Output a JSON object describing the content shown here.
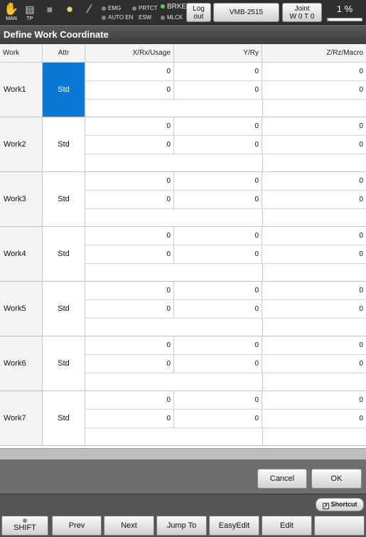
{
  "statusbar": {
    "mode_icon": "hand-icon",
    "mode_label": "MAN",
    "tp_icon": "teach-pendant-icon",
    "tp_label": "TP",
    "indicators": {
      "emg": "EMG",
      "autoen": "AUTO EN",
      "prtct": "PRTCT",
      "esw": "ESW",
      "brke": "BRKE",
      "mlck": "MLCK"
    },
    "logout_line1": "Log",
    "logout_line2": "out",
    "robot_name": "VMB-2515",
    "joint_line1": "Joint",
    "joint_line2": "W 0 T 0",
    "speed_text": "1 %",
    "speed_percent": 1
  },
  "title": "Define Work Coordinate",
  "table": {
    "columns": [
      "Work",
      "Attr",
      "X/Rx/Usage",
      "Y/Ry",
      "Z/Rz/Macro"
    ],
    "rows": [
      {
        "work": "Work1",
        "attr": "Std",
        "pos": [
          "0",
          "0",
          "0"
        ],
        "rot": [
          "0",
          "0",
          "0"
        ],
        "selected": true
      },
      {
        "work": "Work2",
        "attr": "Std",
        "pos": [
          "0",
          "0",
          "0"
        ],
        "rot": [
          "0",
          "0",
          "0"
        ]
      },
      {
        "work": "Work3",
        "attr": "Std",
        "pos": [
          "0",
          "0",
          "0"
        ],
        "rot": [
          "0",
          "0",
          "0"
        ]
      },
      {
        "work": "Work4",
        "attr": "Std",
        "pos": [
          "0",
          "0",
          "0"
        ],
        "rot": [
          "0",
          "0",
          "0"
        ]
      },
      {
        "work": "Work5",
        "attr": "Std",
        "pos": [
          "0",
          "0",
          "0"
        ],
        "rot": [
          "0",
          "0",
          "0"
        ]
      },
      {
        "work": "Work6",
        "attr": "Std",
        "pos": [
          "0",
          "0",
          "0"
        ],
        "rot": [
          "0",
          "0",
          "0"
        ]
      },
      {
        "work": "Work7",
        "attr": "Std",
        "pos": [
          "0",
          "0",
          "0"
        ],
        "rot": [
          "0",
          "0",
          "0"
        ]
      }
    ]
  },
  "dialog": {
    "cancel": "Cancel",
    "ok": "OK"
  },
  "softkeys": {
    "shortcut": "Shortcut",
    "shift": "SHIFT",
    "prev": "Prev",
    "next": "Next",
    "jump_to": "Jump To",
    "easyedit": "EasyEdit",
    "edit": "Edit",
    "blank": ""
  },
  "colors": {
    "selection": "#0b78d6",
    "brke_indicator": "#4bd34b",
    "background": "#6e6e6e"
  }
}
